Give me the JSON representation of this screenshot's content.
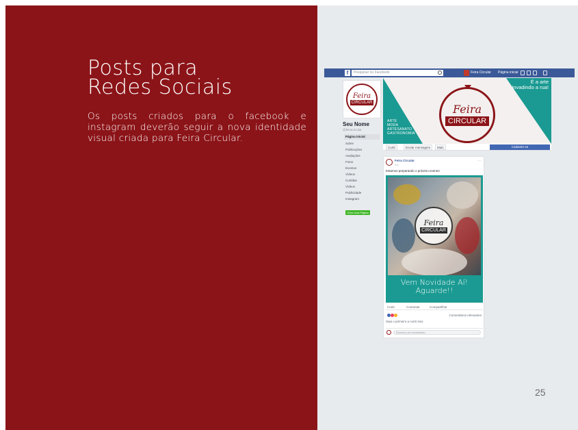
{
  "slide": {
    "title_line1": "Posts para",
    "title_line2": "Redes Sociais",
    "description": "Os posts criados para o facebook e instagram deverão seguir a nova identidade visual criada para Feira Circular.",
    "page_number": "25",
    "colors": {
      "brand_red": "#8b1418",
      "panel_gray": "#e8ebee",
      "teal": "#1a9a92",
      "facebook_blue": "#3b5998"
    }
  },
  "mockup": {
    "topbar": {
      "logo": "f",
      "search_placeholder": "Pesquisar no Facebook",
      "user_label": "Feira Circular",
      "home_label": "Página inicial",
      "icons": [
        "friends-icon",
        "messages-icon",
        "notifications-icon",
        "help-icon"
      ]
    },
    "sidebar": {
      "profile_logo_top": "Feira",
      "profile_logo_bottom": "CIRCULAR",
      "page_name": "Seu Nome",
      "handle": "@feiracircular",
      "items": [
        {
          "label": "Página inicial",
          "active": true
        },
        {
          "label": "Sobre"
        },
        {
          "label": "Publicações"
        },
        {
          "label": "Avaliações"
        },
        {
          "label": "Fotos"
        },
        {
          "label": "Eventos"
        },
        {
          "label": "Vídeos"
        },
        {
          "label": "Curtidas"
        },
        {
          "label": "Vídeos"
        },
        {
          "label": "Publicidade"
        },
        {
          "label": "Instagram"
        }
      ],
      "create_page_button": "Criar uma Página"
    },
    "cover": {
      "tagline": "É a arte invadindo a rua!",
      "logo_top": "Feira",
      "logo_bottom": "CIRCULAR",
      "words": [
        "ARTE",
        "MODA",
        "ARTESANATO",
        "GASTRONOMIA"
      ]
    },
    "actionbar": {
      "like": "Curtir",
      "message": "Enviar mensagem",
      "more": "Mais",
      "signup": "Cadastre-se"
    },
    "post": {
      "author": "Feira Circular",
      "time": "1 h",
      "menu": "···",
      "caption": "Estamos preparando o próximo evento!",
      "logo_top": "Feira",
      "logo_bottom": "CIRCULAR",
      "headline": "Vem Novidade Aí! Aguarde!!",
      "actions": {
        "like": "Curtir",
        "comment": "Comentar",
        "share": "Compartilhar"
      },
      "comments_link": "Comentários relevantes",
      "liked_by": "Seja o primeiro a curtir isso",
      "comment_placeholder": "Escreva um comentário..."
    }
  }
}
